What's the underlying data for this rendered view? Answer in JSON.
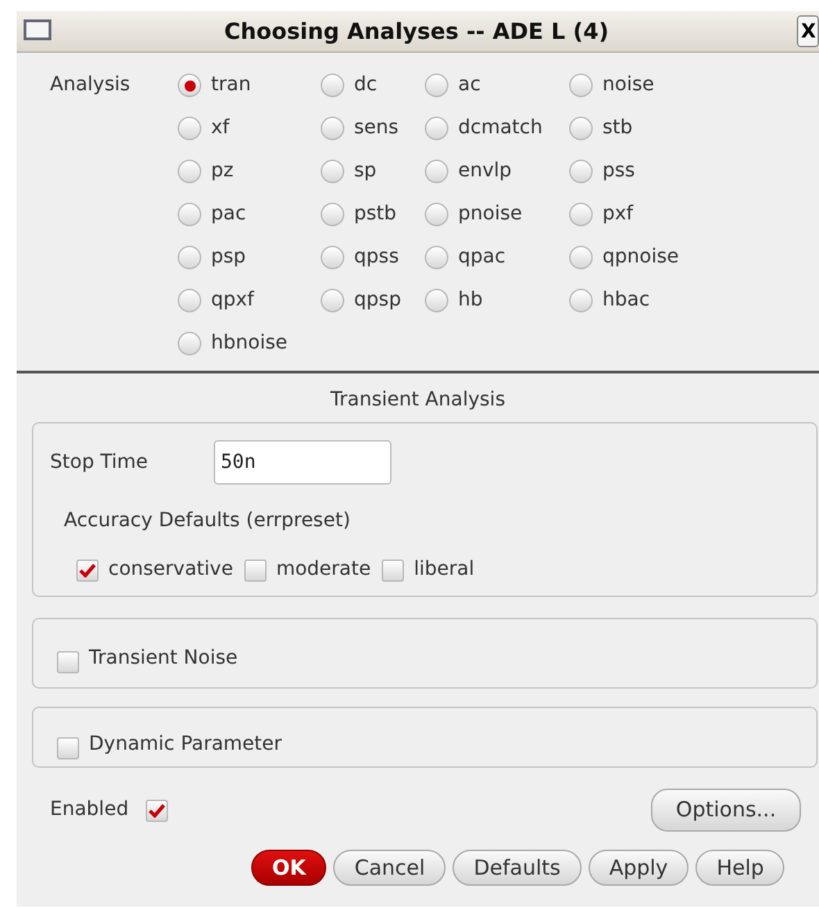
{
  "window": {
    "title": "Choosing Analyses -- ADE L (4)",
    "close": "X"
  },
  "analysis": {
    "label": "Analysis",
    "options": [
      {
        "label": "tran",
        "selected": true
      },
      {
        "label": "dc",
        "selected": false
      },
      {
        "label": "ac",
        "selected": false
      },
      {
        "label": "noise",
        "selected": false
      },
      {
        "label": "xf",
        "selected": false
      },
      {
        "label": "sens",
        "selected": false
      },
      {
        "label": "dcmatch",
        "selected": false
      },
      {
        "label": "stb",
        "selected": false
      },
      {
        "label": "pz",
        "selected": false
      },
      {
        "label": "sp",
        "selected": false
      },
      {
        "label": "envlp",
        "selected": false
      },
      {
        "label": "pss",
        "selected": false
      },
      {
        "label": "pac",
        "selected": false
      },
      {
        "label": "pstb",
        "selected": false
      },
      {
        "label": "pnoise",
        "selected": false
      },
      {
        "label": "pxf",
        "selected": false
      },
      {
        "label": "psp",
        "selected": false
      },
      {
        "label": "qpss",
        "selected": false
      },
      {
        "label": "qpac",
        "selected": false
      },
      {
        "label": "qpnoise",
        "selected": false
      },
      {
        "label": "qpxf",
        "selected": false
      },
      {
        "label": "qpsp",
        "selected": false
      },
      {
        "label": "hb",
        "selected": false
      },
      {
        "label": "hbac",
        "selected": false
      },
      {
        "label": "hbnoise",
        "selected": false
      }
    ]
  },
  "section_title": "Transient Analysis",
  "stop_time": {
    "label": "Stop Time",
    "value": "50n"
  },
  "accuracy": {
    "label": "Accuracy Defaults (errpreset)",
    "options": [
      {
        "label": "conservative",
        "checked": true
      },
      {
        "label": "moderate",
        "checked": false
      },
      {
        "label": "liberal",
        "checked": false
      }
    ]
  },
  "transient_noise": {
    "label": "Transient Noise",
    "checked": false
  },
  "dynamic_parameter": {
    "label": "Dynamic Parameter",
    "checked": false
  },
  "enabled": {
    "label": "Enabled",
    "checked": true
  },
  "options_button": "Options...",
  "buttons": [
    {
      "label": "OK",
      "kind": "primary"
    },
    {
      "label": "Cancel",
      "kind": "normal"
    },
    {
      "label": "Defaults",
      "kind": "normal"
    },
    {
      "label": "Apply",
      "kind": "normal"
    },
    {
      "label": "Help",
      "kind": "normal"
    }
  ]
}
